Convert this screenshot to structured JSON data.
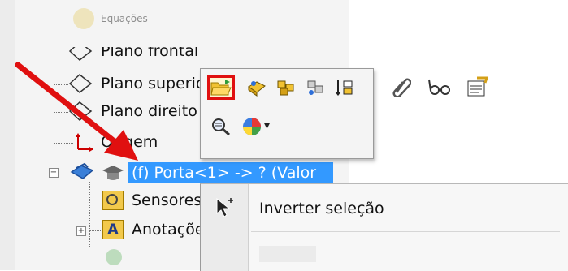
{
  "tree": {
    "top_item": "Equações",
    "items": [
      {
        "label": "Plano frontal"
      },
      {
        "label": "Plano superior"
      },
      {
        "label": "Plano direito"
      },
      {
        "label": "Origem"
      },
      {
        "label": "(f) Porta<1> -> ? (Valor"
      },
      {
        "label": "Sensores"
      },
      {
        "label": "Anotações"
      }
    ]
  },
  "toolbar": {
    "icons": [
      "open-folder-icon",
      "part-icon",
      "assembly-icon",
      "component-icon",
      "sort-icon",
      "paperclip-icon",
      "glasses-icon",
      "properties-icon",
      "zoom-icon",
      "appearance-icon"
    ],
    "dropdown_arrow": "▾"
  },
  "context_menu": {
    "item_label": "Inverter seleção"
  },
  "colors": {
    "selection": "#3399ff",
    "highlight_border": "#e01010",
    "arrow": "#e01010"
  }
}
